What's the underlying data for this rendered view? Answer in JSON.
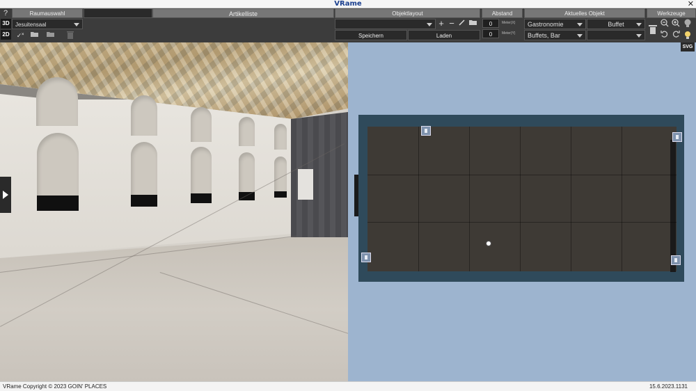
{
  "app": {
    "title": "VRame"
  },
  "toolbar": {
    "raumauswahl": {
      "header": "Raumauswahl",
      "room_value": "Jesuitensaal"
    },
    "artikelliste": {
      "header": "Artikelliste"
    },
    "objektlayout": {
      "header": "Objektlayout",
      "layout_value": "",
      "save_label": "Speichern",
      "load_label": "Laden"
    },
    "abstand": {
      "header": "Abstand",
      "x_value": "0",
      "x_unit": "Meter(X)",
      "y_value": "0",
      "y_unit": "Meter(Y)"
    },
    "aktuelles_objekt": {
      "header": "Aktuelles Objekt",
      "category": "Gastronomie",
      "type": "Buffet",
      "subcategory": "Buffets, Bar",
      "variant": ""
    },
    "werkzeuge": {
      "header": "Werkzeuge"
    },
    "view_3d": "3D",
    "view_2d": "2D",
    "help": "?"
  },
  "view2d": {
    "svg_label": "SVG"
  },
  "statusbar": {
    "copyright": "VRame Copyright © 2023 GOIN' PLACES",
    "version": "15.6.2023.1131"
  }
}
